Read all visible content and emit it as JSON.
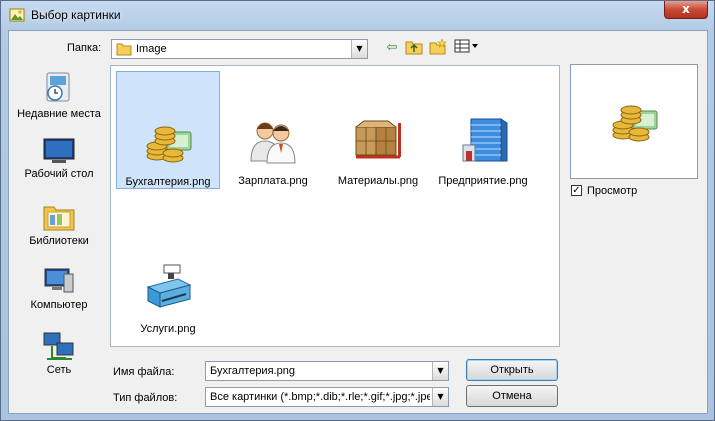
{
  "window": {
    "title": "Выбор картинки",
    "close_glyph": "x"
  },
  "folder": {
    "label": "Папка:",
    "value": "Image"
  },
  "places": [
    {
      "label": "Недавние места",
      "icon": "recent-places-icon"
    },
    {
      "label": "Рабочий стол",
      "icon": "desktop-icon"
    },
    {
      "label": "Библиотеки",
      "icon": "libraries-icon"
    },
    {
      "label": "Компьютер",
      "icon": "computer-icon"
    },
    {
      "label": "Сеть",
      "icon": "network-icon"
    }
  ],
  "files": [
    {
      "name": "Бухгалтерия.png",
      "icon": "accounting-coins-icon",
      "selected": true
    },
    {
      "name": "Зарплата.png",
      "icon": "salary-people-icon",
      "selected": false
    },
    {
      "name": "Материалы.png",
      "icon": "materials-boxes-icon",
      "selected": false
    },
    {
      "name": "Предприятие.png",
      "icon": "enterprise-building-icon",
      "selected": false
    },
    {
      "name": "Услуги.png",
      "icon": "services-cash-register-icon",
      "selected": false
    }
  ],
  "preview": {
    "checkbox_label": "Просмотр",
    "checked": true
  },
  "filename": {
    "label": "Имя файла:",
    "value": "Бухгалтерия.png"
  },
  "filetype": {
    "label": "Тип файлов:",
    "value": "Все картинки (*.bmp;*.dib;*.rle;*.gif;*.jpg;*.jpeg"
  },
  "buttons": {
    "open": "Открыть",
    "cancel": "Отмена"
  }
}
